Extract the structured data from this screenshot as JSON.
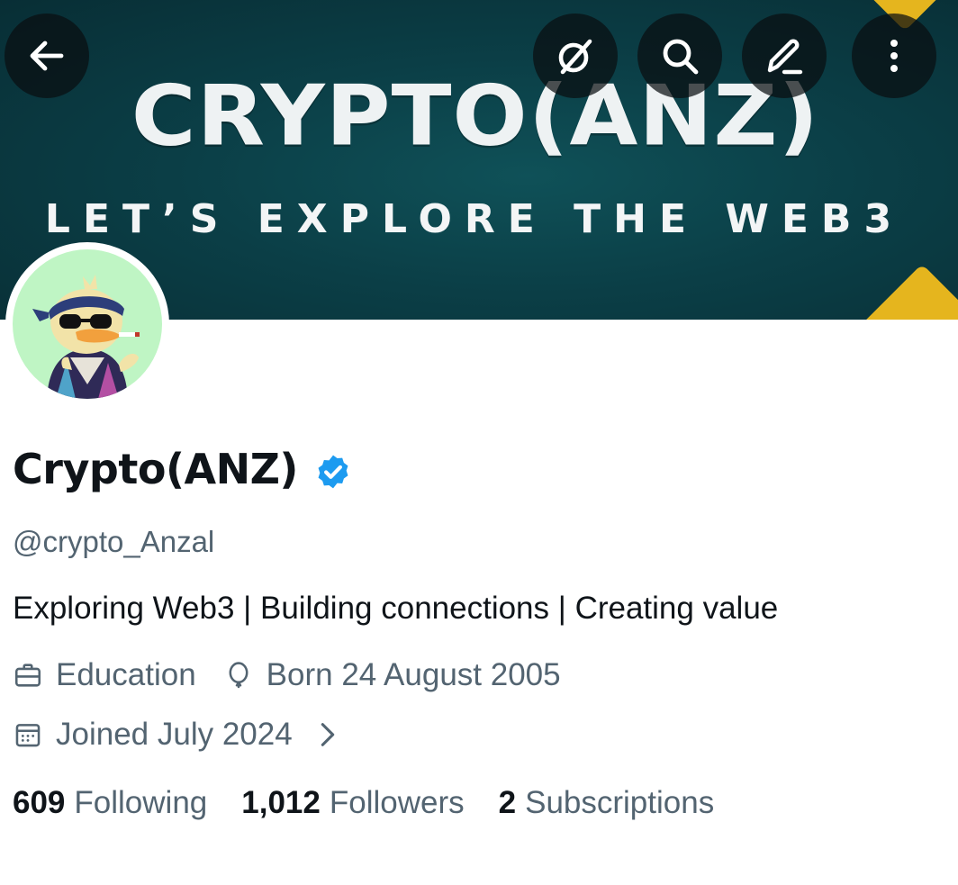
{
  "banner": {
    "title": "CRYPTO(ANZ)",
    "tagline": "LET’S EXPLORE THE WEB3",
    "colors": {
      "background": "#0b3f47",
      "accent": "#e5b51e"
    }
  },
  "toolbar": {
    "back_icon": "arrow-left-icon",
    "grok_icon": "grok-icon",
    "search_icon": "search-icon",
    "edit_icon": "pencil-icon",
    "more_icon": "more-vertical-icon"
  },
  "profile": {
    "display_name": "Crypto(ANZ)",
    "verified": true,
    "verified_color": "#1d9bf0",
    "handle": "@crypto_Anzal",
    "bio": "Exploring Web3 | Building connections | Creating value",
    "category": "Education",
    "birthday": "Born 24 August 2005",
    "joined": "Joined July 2024"
  },
  "stats": {
    "following_count": "609",
    "following_label": "Following",
    "followers_count": "1,012",
    "followers_label": "Followers",
    "subscriptions_count": "2",
    "subscriptions_label": "Subscriptions"
  }
}
